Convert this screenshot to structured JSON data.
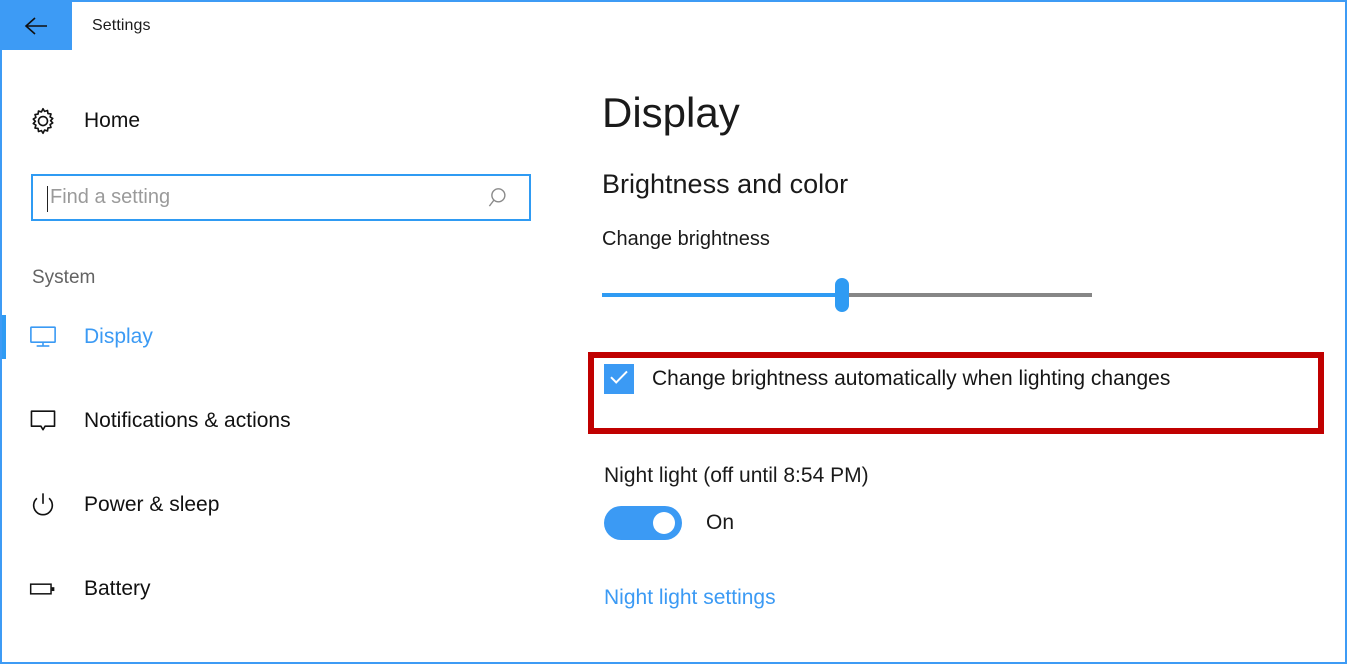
{
  "window": {
    "border_color": "#3d9bf5",
    "accent_color": "#3b9af4",
    "highlight_color": "#c00000"
  },
  "titlebar": {
    "back_icon": "back-arrow-icon",
    "title": "Settings"
  },
  "sidebar": {
    "home": {
      "icon": "gear-icon",
      "label": "Home"
    },
    "search": {
      "icon": "search-icon",
      "value": "",
      "placeholder": "Find a setting"
    },
    "group_label": "System",
    "items": [
      {
        "label": "Display",
        "icon": "monitor-icon",
        "selected": true
      },
      {
        "label": "Notifications & actions",
        "icon": "speech-bubble-icon",
        "selected": false
      },
      {
        "label": "Power & sleep",
        "icon": "power-icon",
        "selected": false
      },
      {
        "label": "Battery",
        "icon": "battery-icon",
        "selected": false
      }
    ]
  },
  "main": {
    "page_title": "Display",
    "section_title": "Brightness and color",
    "brightness": {
      "label": "Change brightness",
      "value": 49,
      "min": 0,
      "max": 100
    },
    "auto_brightness": {
      "label": "Change brightness automatically when lighting changes",
      "checked": true,
      "check_glyph": "checkmark-icon",
      "highlighted": true
    },
    "night_light": {
      "label": "Night light (off until 8:54 PM)",
      "toggle_state": "On",
      "toggle_on": true,
      "link_label": "Night light settings"
    }
  }
}
